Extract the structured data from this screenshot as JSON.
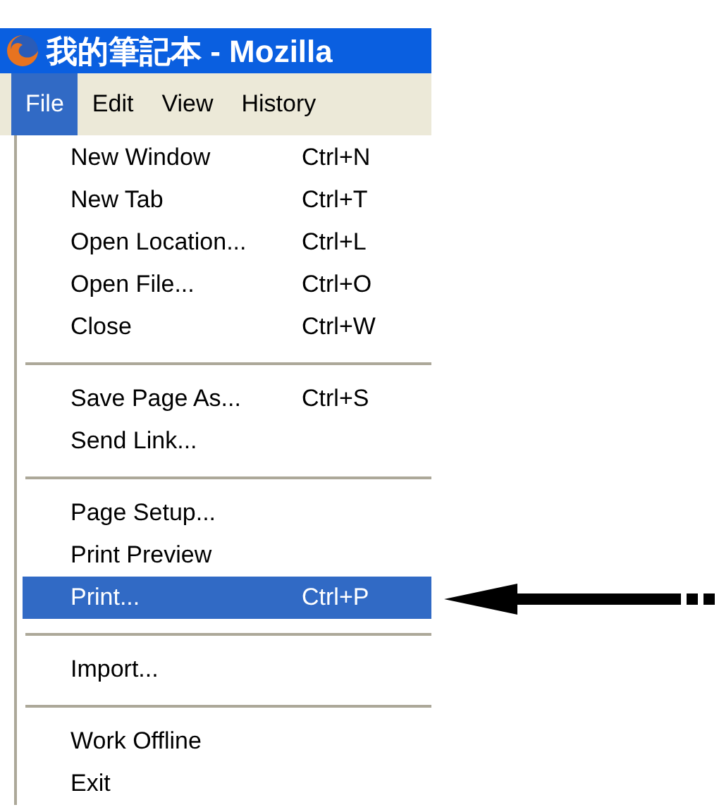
{
  "window": {
    "title": "我的筆記本 - Mozilla"
  },
  "menu_bar": [
    {
      "label": "File",
      "selected": true
    },
    {
      "label": "Edit",
      "selected": false
    },
    {
      "label": "View",
      "selected": false
    },
    {
      "label": "History",
      "selected": false
    }
  ],
  "menu": [
    {
      "kind": "item",
      "label": "New Window",
      "shortcut": "Ctrl+N",
      "selected": false
    },
    {
      "kind": "item",
      "label": "New Tab",
      "shortcut": "Ctrl+T",
      "selected": false
    },
    {
      "kind": "item",
      "label": "Open Location...",
      "shortcut": "Ctrl+L",
      "selected": false
    },
    {
      "kind": "item",
      "label": "Open File...",
      "shortcut": "Ctrl+O",
      "selected": false
    },
    {
      "kind": "item",
      "label": "Close",
      "shortcut": "Ctrl+W",
      "selected": false
    },
    {
      "kind": "separator"
    },
    {
      "kind": "item",
      "label": "Save Page As...",
      "shortcut": "Ctrl+S",
      "selected": false
    },
    {
      "kind": "item",
      "label": "Send Link...",
      "selected": false
    },
    {
      "kind": "separator"
    },
    {
      "kind": "item",
      "label": "Page Setup...",
      "selected": false
    },
    {
      "kind": "item",
      "label": "Print Preview",
      "selected": false
    },
    {
      "kind": "item",
      "label": "Print...",
      "shortcut": "Ctrl+P",
      "selected": true
    },
    {
      "kind": "separator"
    },
    {
      "kind": "item",
      "label": "Import...",
      "selected": false
    },
    {
      "kind": "separator"
    },
    {
      "kind": "item",
      "label": "Work Offline",
      "selected": false
    },
    {
      "kind": "item",
      "label": "Exit",
      "selected": false
    }
  ]
}
